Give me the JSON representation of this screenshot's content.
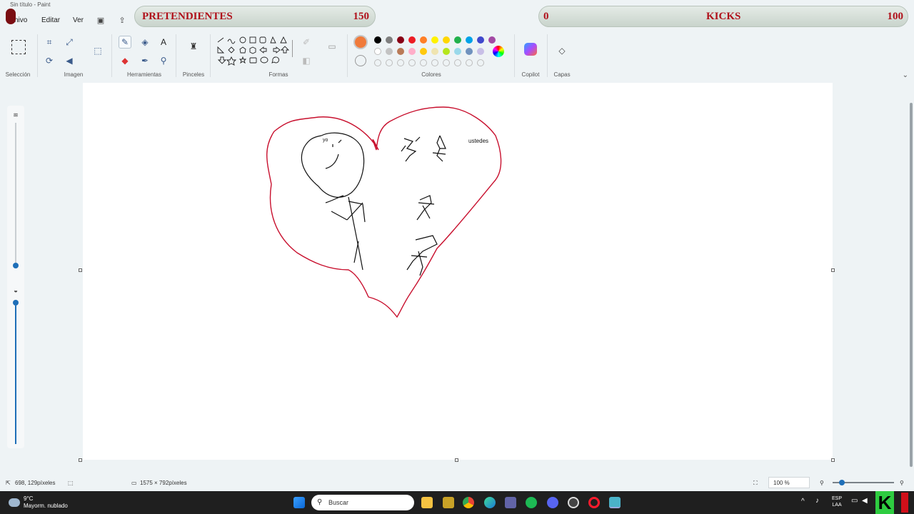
{
  "window": {
    "title": "Sin título - Paint"
  },
  "menu": {
    "archivo": "hivo",
    "editar": "Editar",
    "ver": "Ver"
  },
  "overlay": {
    "left_label": "PRETENDIENTES",
    "left_value": "150",
    "right_value_left": "0",
    "right_label": "KICKS",
    "right_value": "100"
  },
  "ribbon": {
    "groups": {
      "seleccion": "Selección",
      "imagen": "Imagen",
      "herramientas": "Herramientas",
      "pinceles": "Pinceles",
      "formas": "Formas",
      "colores": "Colores",
      "copilot": "Copilot",
      "capas": "Capas"
    },
    "colors": {
      "primary": "#f07a3a",
      "secondary": "#ffffff",
      "row1": [
        "#000000",
        "#7f7f7f",
        "#880015",
        "#ed1c24",
        "#ff7f27",
        "#fff200",
        "#ffd700",
        "#22b14c",
        "#00a2e8",
        "#3f48cc",
        "#a349a4"
      ],
      "row2": [
        "#ffffff",
        "#c3c3c3",
        "#b97a57",
        "#ffaec9",
        "#ffc90e",
        "#efe4b0",
        "#b5e61d",
        "#99d9ea",
        "#7092be",
        "#c8bfe7"
      ]
    }
  },
  "drawing": {
    "label_yo": "yo",
    "label_ustedes": "ustedes",
    "heart_color": "#c8102e",
    "ink_color": "#111111"
  },
  "status": {
    "cursor_position": "698, 129píxeles",
    "canvas_size": "1575 × 792píxeles",
    "zoom": "100 %"
  },
  "taskbar": {
    "weather_temp": "9°C",
    "weather_desc": "Mayorm. nublado",
    "search_placeholder": "Buscar",
    "lang_line1": "ESP",
    "lang_line2": "LAA"
  }
}
